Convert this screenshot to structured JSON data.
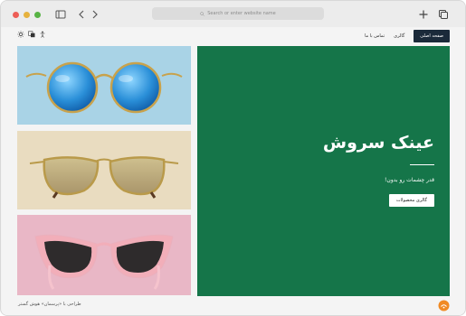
{
  "browser": {
    "address_placeholder": "Search or enter website name",
    "traffic_lights": {
      "close": "#ed5e57",
      "minimize": "#e6b23e",
      "zoom": "#58b345"
    }
  },
  "nav": {
    "items": [
      {
        "label": "صفحه اصلی",
        "active": true
      },
      {
        "label": "گالری",
        "active": false
      },
      {
        "label": "تماس با ما",
        "active": false
      }
    ]
  },
  "hero": {
    "title": "عینک سروش",
    "subtitle": "قدر چشمات رو بدون!",
    "button_label": "گالری محصولات",
    "background": "#157549"
  },
  "products": [
    {
      "name": "round-mirrored-blue-sunglasses",
      "background": "#a9d3e6"
    },
    {
      "name": "gold-aviator-sunglasses",
      "background": "#e9dcc0"
    },
    {
      "name": "cat-eye-pink-sunglasses",
      "background": "#e9b7c6"
    }
  ],
  "footer": {
    "note": "طراحی با «پرسمان» هوش گستر",
    "logo_icon": "orange-badge-icon"
  },
  "icons": [
    "sidebar-toggle-icon",
    "back-arrow-icon",
    "forward-arrow-icon",
    "search-icon",
    "new-tab-icon",
    "tabs-overview-icon",
    "sun-icon",
    "translate-icon",
    "accessibility-icon"
  ]
}
